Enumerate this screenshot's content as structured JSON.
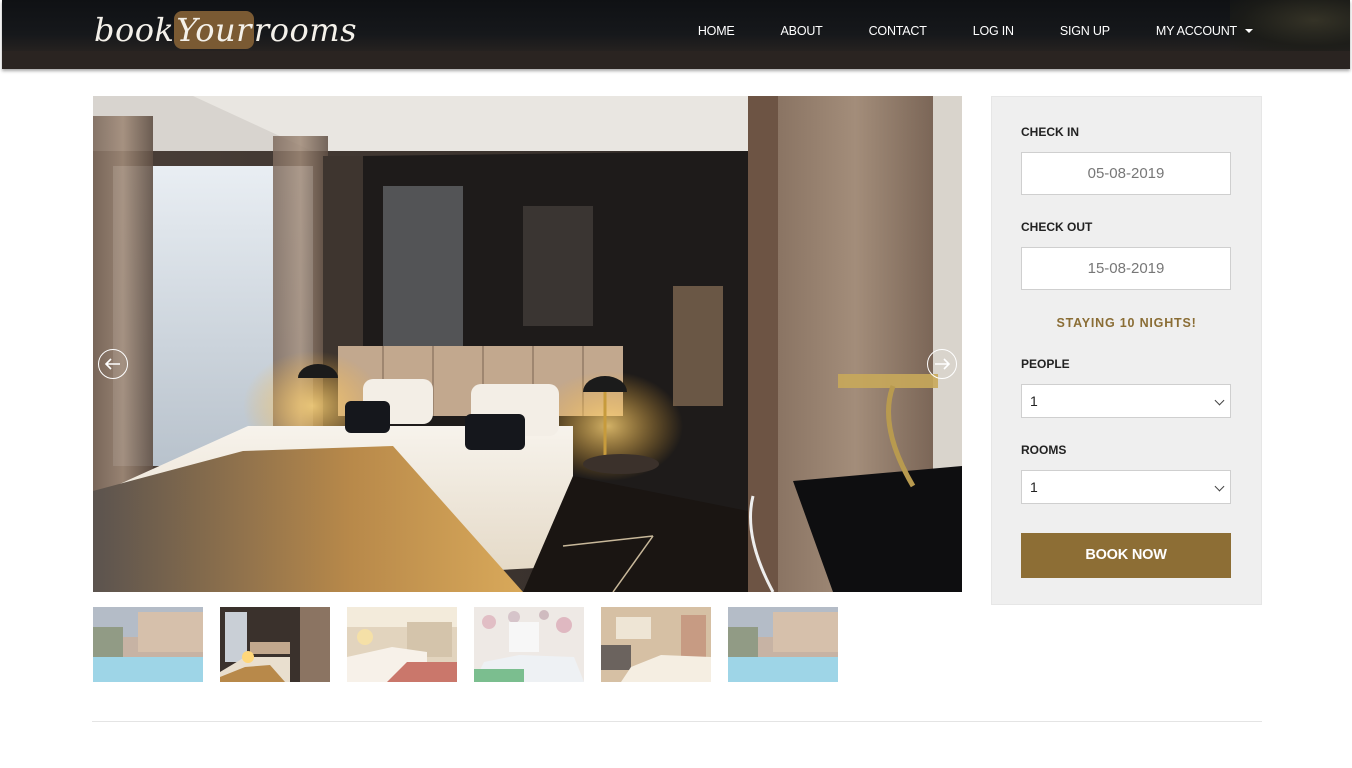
{
  "header": {
    "logo_prefix": "book",
    "logo_highlight": "Your",
    "logo_suffix": "rooms",
    "nav": [
      "HOME",
      "ABOUT",
      "CONTACT",
      "LOG IN",
      "SIGN UP",
      "MY ACCOUNT"
    ]
  },
  "gallery": {
    "prev_icon": "arrow-left-icon",
    "next_icon": "arrow-right-icon",
    "thumbnails": [
      "pool",
      "bedroom-dark",
      "bedroom-warm",
      "bedroom-floral",
      "bedroom-classic",
      "pool"
    ],
    "active_thumbnail": 1
  },
  "booking": {
    "check_in_label": "CHECK IN",
    "check_in_value": "05-08-2019",
    "check_out_label": "CHECK OUT",
    "check_out_value": "15-08-2019",
    "nights_text": "STAYING 10 NIGHTS!",
    "people_label": "PEOPLE",
    "people_value": "1",
    "rooms_label": "ROOMS",
    "rooms_value": "1",
    "book_button": "BOOK NOW"
  },
  "colors": {
    "accent": "#8d6e35",
    "panel_bg": "#efefef",
    "header_bg": "#16181b"
  }
}
